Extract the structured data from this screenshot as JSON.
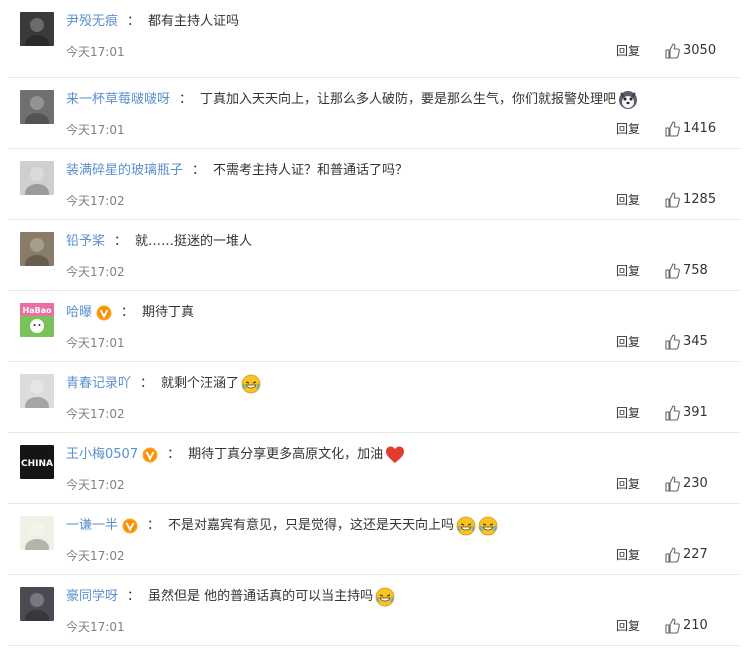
{
  "reply_label": "回复",
  "comments": [
    {
      "user": "尹殁无痕",
      "sep": "：",
      "text": "都有主持人证吗",
      "time": "今天17:01",
      "likes": "3050",
      "verified": false,
      "emojis": [],
      "avatar_color": "#3a3a3a"
    },
    {
      "user": "来一杯草莓啵啵呀",
      "sep": "：",
      "text": "丁真加入天天向上，让那么多人破防，要是那么生气，你们就报警处理吧",
      "time": "今天17:01",
      "likes": "1416",
      "verified": false,
      "emojis": [
        "husky-emoji"
      ],
      "avatar_color": "#6f6f6f"
    },
    {
      "user": "装满碎星的玻璃瓶子",
      "sep": "：",
      "text": "不需考主持人证？和普通话了吗？",
      "time": "今天17:02",
      "likes": "1285",
      "verified": false,
      "emojis": [],
      "avatar_color": "#cfcfcf"
    },
    {
      "user": "铅予桨",
      "sep": "：",
      "text": "就……挺迷的一堆人",
      "time": "今天17:02",
      "likes": "758",
      "verified": false,
      "emojis": [],
      "avatar_color": "#8a7d68"
    },
    {
      "user": "哈曝",
      "sep": "：",
      "text": "期待丁真",
      "time": "今天17:01",
      "likes": "345",
      "verified": true,
      "emojis": [],
      "avatar_color": "#79c25a"
    },
    {
      "user": "青春记录吖",
      "sep": "：",
      "text": "就剩个汪涵了",
      "time": "今天17:02",
      "likes": "391",
      "verified": false,
      "emojis": [
        "laugh-cry-emoji"
      ],
      "avatar_color": "#dcdcdc"
    },
    {
      "user": "王小梅0507",
      "sep": "：",
      "text": "期待丁真分享更多高原文化，加油",
      "time": "今天17:02",
      "likes": "230",
      "verified": true,
      "emojis": [
        "heart-emoji"
      ],
      "avatar_color": "#151515"
    },
    {
      "user": "一谦一半",
      "sep": "：",
      "text": "不是对嘉宾有意见，只是觉得，这还是天天向上吗",
      "time": "今天17:02",
      "likes": "227",
      "verified": true,
      "emojis": [
        "laugh-cry-emoji",
        "laugh-cry-emoji"
      ],
      "avatar_color": "#eef2e6"
    },
    {
      "user": "豪同学呀",
      "sep": "：",
      "text": "虽然但是 他的普通话真的可以当主持吗",
      "time": "今天17:01",
      "likes": "210",
      "verified": false,
      "emojis": [
        "laugh-cry-emoji"
      ],
      "avatar_color": "#4a4a52"
    }
  ],
  "colors": {
    "username": "#5b8fd0",
    "verified_badge": "#f5a623",
    "heart": "#e23b2e",
    "emoji_face": "#f7c325"
  },
  "avatar_labels": {
    "4": "HaBao",
    "6": "CHINA"
  }
}
